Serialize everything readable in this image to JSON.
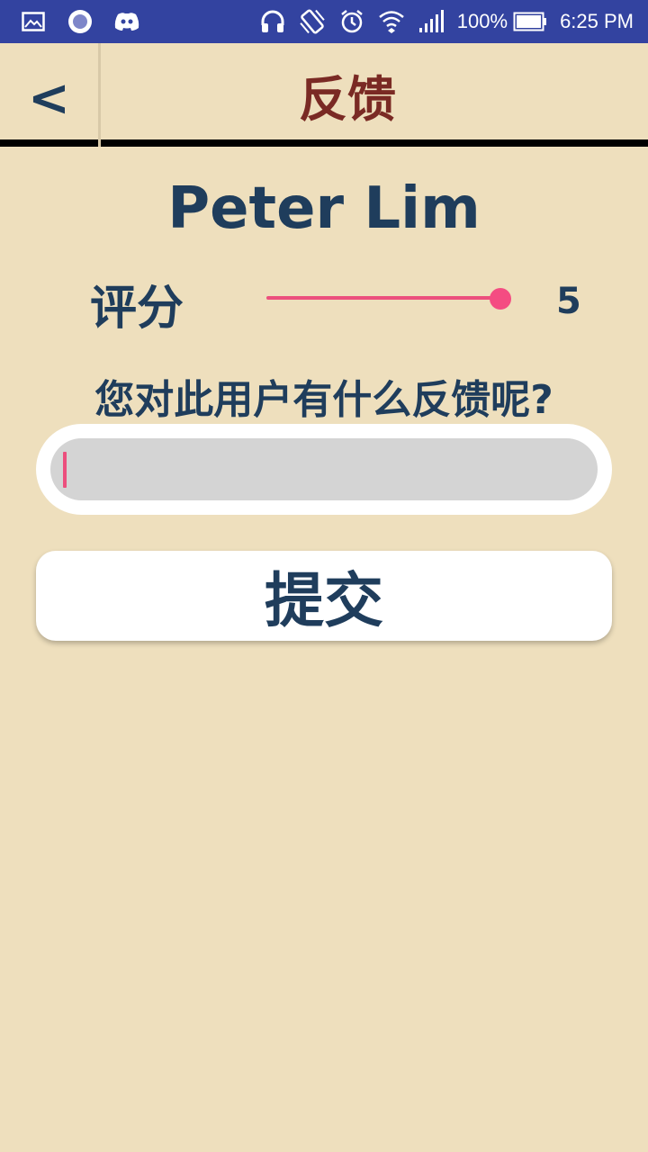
{
  "status_bar": {
    "battery": "100%",
    "time": "6:25 PM",
    "icons": [
      "gallery-icon",
      "record-icon",
      "discord-icon",
      "headphones-icon",
      "vibrate-icon",
      "alarm-icon",
      "wifi-icon",
      "signal-icon",
      "battery-icon"
    ]
  },
  "header": {
    "back_label": "<",
    "title": "反馈"
  },
  "user": {
    "name": "Peter Lim"
  },
  "rating": {
    "label": "评分",
    "value": "5",
    "level_fraction": 1.0
  },
  "feedback": {
    "question": "您对此用户有什么反馈呢?",
    "input_value": ""
  },
  "submit_label": "提交",
  "colors": {
    "background": "#EEDFBD",
    "status_bar": "#3343A0",
    "primary_text": "#1F3D5C",
    "title_text": "#7A2A24",
    "accent": "#EC4F7D"
  }
}
